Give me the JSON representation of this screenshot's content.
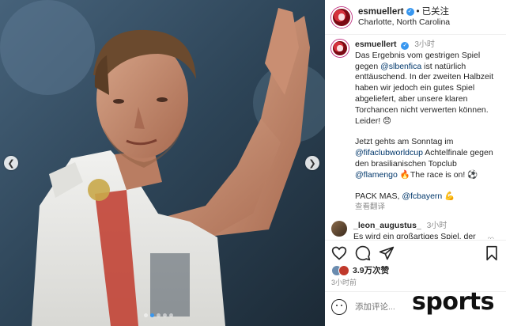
{
  "post_header": {
    "username": "esmuellert",
    "follow_label": "已关注",
    "separator": "•",
    "location": "Charlotte, North Carolina"
  },
  "caption": {
    "username": "esmuellert",
    "time": "3小时",
    "paragraph1": "Das Ergebnis vom gestrigen Spiel gegen",
    "mention1": "@slbenfica",
    "paragraph1b": "ist natürlich enttäuschend. In der zweiten Halbzeit haben wir jedoch ein gutes Spiel abgeliefert, aber unsere klaren Torchancen nicht verwerten können. Leider! 😞",
    "paragraph2a": "Jetzt gehts am Sonntag im",
    "mention2": "@fifaclubworldcup",
    "paragraph2b": "Achtelfinale gegen den brasilianischen Topclub",
    "mention3": "@flamengo",
    "paragraph2c": "🔥The race is on! ⚽",
    "paragraph3a": "PACK MAS,",
    "mention4": "@fcbayern",
    "paragraph3b": "💪",
    "translate_label": "查看翻译"
  },
  "comment": {
    "username": "_leon_augustus_",
    "time": "3小时",
    "text": "Es wird ein großartiges Spiel, der beste Verein Brasiliens gegen den"
  },
  "actions": {
    "likes_count": "3.9万次赞",
    "post_time": "3小时前",
    "comment_placeholder": "添加评论..."
  },
  "watermark": "sports",
  "carousel": {
    "slide_count": 5,
    "active_index": 1
  },
  "colors": {
    "link": "#00376b",
    "verified": "#3897f0",
    "secondary_text": "#8e8e8e"
  }
}
